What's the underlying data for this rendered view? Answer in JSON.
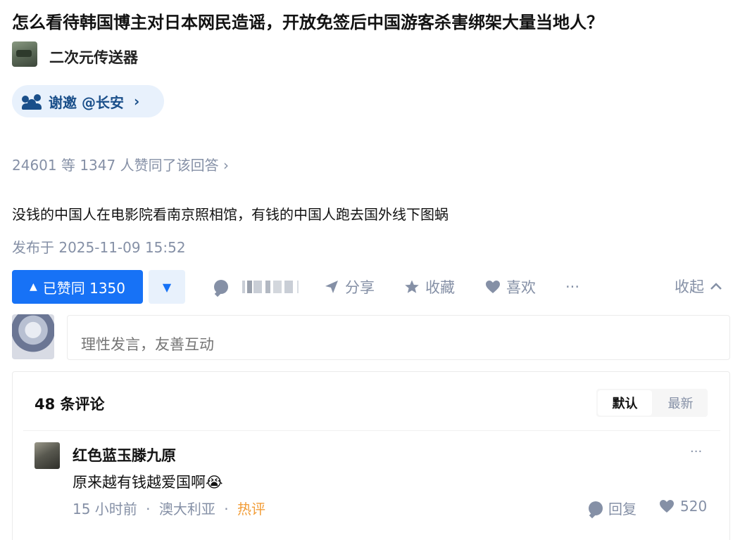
{
  "question": {
    "title": "怎么看待韩国博主对日本网民造谣，开放免签后中国游客杀害绑架大量当地人？"
  },
  "author": {
    "name": "二次元传送器",
    "avatar_icon": "avatar-image"
  },
  "invite": {
    "label": "谢邀 @长安",
    "icon": "invite-people-icon",
    "chevron": "›"
  },
  "agree": {
    "text": "24601 等 1347 人赞同了该回答 ›"
  },
  "answer": {
    "content": "没钱的中国人在电影院看南京照相馆，有钱的中国人跑去国外线下图蜗",
    "published": "发布于 2025-11-09 15:52"
  },
  "actions": {
    "vote_label": "已赞同 1350",
    "vote_icon": "▲",
    "downvote_icon": "▼",
    "share": "分享",
    "collect": "收藏",
    "like": "喜欢",
    "more": "···",
    "collapse": "收起"
  },
  "comment_box": {
    "placeholder": "理性发言，友善互动"
  },
  "comments": {
    "count_label": "48 条评论",
    "sort": [
      "默认",
      "最新"
    ],
    "items": [
      {
        "user": "红色蓝玉滕九原",
        "text": "原来越有钱越爱国啊😭",
        "time": "15 小时前",
        "sep": "·",
        "location": "澳大利亚",
        "tag": "热评",
        "reply": "回复",
        "likes": "520",
        "more": "···"
      }
    ]
  },
  "colors": {
    "primary": "#1772f6",
    "muted": "#8590a6",
    "hot": "#f29d38",
    "pill_bg": "#e8f1fc"
  }
}
